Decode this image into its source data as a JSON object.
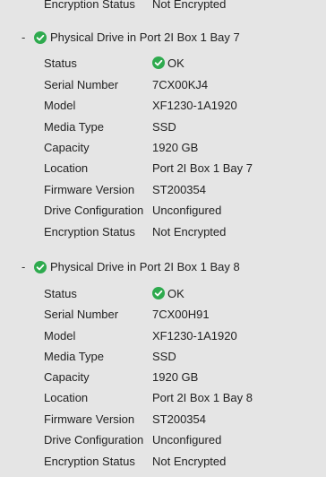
{
  "colors": {
    "background": "#e5e5e5",
    "ok_green": "#2eaa4e",
    "text": "#222222"
  },
  "partial_row": {
    "label": "Encryption Status",
    "value": "Not Encrypted"
  },
  "drives": [
    {
      "toggle": "-",
      "icon": "check-circle-icon",
      "title": "Physical Drive in Port 2I Box 1 Bay 7",
      "properties": [
        {
          "label": "Status",
          "value": "OK",
          "icon": "check-circle-icon"
        },
        {
          "label": "Serial Number",
          "value": "7CX00KJ4"
        },
        {
          "label": "Model",
          "value": "XF1230-1A1920"
        },
        {
          "label": "Media Type",
          "value": "SSD"
        },
        {
          "label": "Capacity",
          "value": "1920 GB"
        },
        {
          "label": "Location",
          "value": "Port 2I Box 1 Bay 7"
        },
        {
          "label": "Firmware Version",
          "value": "ST200354"
        },
        {
          "label": "Drive Configuration",
          "value": "Unconfigured"
        },
        {
          "label": "Encryption Status",
          "value": "Not Encrypted"
        }
      ]
    },
    {
      "toggle": "-",
      "icon": "check-circle-icon",
      "title": "Physical Drive in Port 2I Box 1 Bay 8",
      "properties": [
        {
          "label": "Status",
          "value": "OK",
          "icon": "check-circle-icon"
        },
        {
          "label": "Serial Number",
          "value": "7CX00H91"
        },
        {
          "label": "Model",
          "value": "XF1230-1A1920"
        },
        {
          "label": "Media Type",
          "value": "SSD"
        },
        {
          "label": "Capacity",
          "value": "1920 GB"
        },
        {
          "label": "Location",
          "value": "Port 2I Box 1 Bay 8"
        },
        {
          "label": "Firmware Version",
          "value": "ST200354"
        },
        {
          "label": "Drive Configuration",
          "value": "Unconfigured"
        },
        {
          "label": "Encryption Status",
          "value": "Not Encrypted"
        }
      ]
    }
  ]
}
